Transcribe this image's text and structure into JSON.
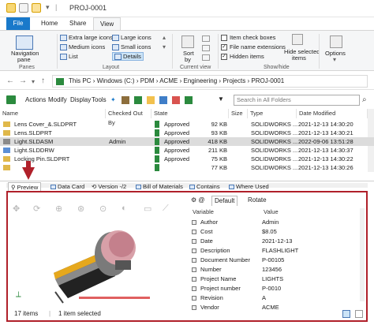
{
  "window": {
    "title": "PROJ-0001"
  },
  "ribbon_tabs": [
    "File",
    "Home",
    "Share",
    "View"
  ],
  "ribbon": {
    "panes": {
      "nav_pane_line1": "Navigation",
      "nav_pane_line2": "pane",
      "group_label": "Panes"
    },
    "layout": {
      "items": [
        "Extra large icons",
        "Large icons",
        "Medium icons",
        "Small icons",
        "List",
        "Details"
      ],
      "group_label": "Layout"
    },
    "current_view": {
      "sort_line1": "Sort",
      "sort_line2": "by",
      "group_label": "Current view"
    },
    "show_hide": {
      "item_check_boxes": "Item check boxes",
      "file_name_extensions": "File name extensions",
      "hidden_items": "Hidden items",
      "hide_selected_line1": "Hide selected",
      "hide_selected_line2": "items",
      "group_label": "Show/hide"
    },
    "options": "Options"
  },
  "address": {
    "path": [
      "This PC",
      "Windows (C:)",
      "PDM",
      "ACME",
      "Engineering",
      "Projects",
      "PROJ-0001"
    ],
    "separator": "›"
  },
  "pdm_toolbar": {
    "menus": [
      "Actions",
      "Modify",
      "Display",
      "Tools"
    ],
    "search_placeholder": "Search in All Folders"
  },
  "file_list": {
    "columns": [
      "Name",
      "Checked Out By",
      "State",
      "Size",
      "Type",
      "Date Modified"
    ],
    "rows": [
      {
        "name": "Lens Cover_&.SLDPRT",
        "checked_out_by": "",
        "state": "Approved",
        "size": "92 KB",
        "type": "SOLIDWORKS ...",
        "date": "2021-12-13 14:30:20"
      },
      {
        "name": "Lens.SLDPRT",
        "checked_out_by": "",
        "state": "Approved",
        "size": "93 KB",
        "type": "SOLIDWORKS ...",
        "date": "2021-12-13 14:30:21"
      },
      {
        "name": "Light.SLDASM",
        "checked_out_by": "Admin",
        "state": "Approved",
        "size": "418 KB",
        "type": "SOLIDWORKS ...",
        "date": "2022-09-06 13:51:28"
      },
      {
        "name": "Light.SLDDRW",
        "checked_out_by": "",
        "state": "Approved",
        "size": "211 KB",
        "type": "SOLIDWORKS ...",
        "date": "2021-12-13 14:30:37"
      },
      {
        "name": "Locking Pin.SLDPRT",
        "checked_out_by": "",
        "state": "Approved",
        "size": "75 KB",
        "type": "SOLIDWORKS ...",
        "date": "2021-12-13 14:30:22"
      },
      {
        "name": "",
        "checked_out_by": "",
        "state": "",
        "size": "77 KB",
        "type": "SOLIDWORKS ...",
        "date": "2021-12-13 14:30:26"
      }
    ],
    "selected_index": 2
  },
  "bottom_tabs": [
    "Preview",
    "Data Card",
    "Version -/2",
    "Bill of Materials",
    "Contains",
    "Where Used"
  ],
  "properties": {
    "tabs": [
      "Default",
      "Rotate"
    ],
    "columns": [
      "Variable",
      "Value"
    ],
    "rows": [
      {
        "k": "Author",
        "v": "Admin"
      },
      {
        "k": "Cost",
        "v": "$8.05"
      },
      {
        "k": "Date",
        "v": "2021-12-13"
      },
      {
        "k": "Description",
        "v": "FLASHLIGHT"
      },
      {
        "k": "Document Number",
        "v": "P-00105"
      },
      {
        "k": "Number",
        "v": "123456"
      },
      {
        "k": "Project Name",
        "v": "LIGHTS"
      },
      {
        "k": "Project number",
        "v": "P-0010"
      },
      {
        "k": "Revision",
        "v": "A"
      },
      {
        "k": "Vendor",
        "v": "ACME"
      }
    ]
  },
  "status": {
    "items": "17 items",
    "selected": "1 item selected"
  },
  "colors": {
    "accent": "#1979ca",
    "highlight_border": "#b0202a",
    "selection": "#dcdcdc"
  }
}
